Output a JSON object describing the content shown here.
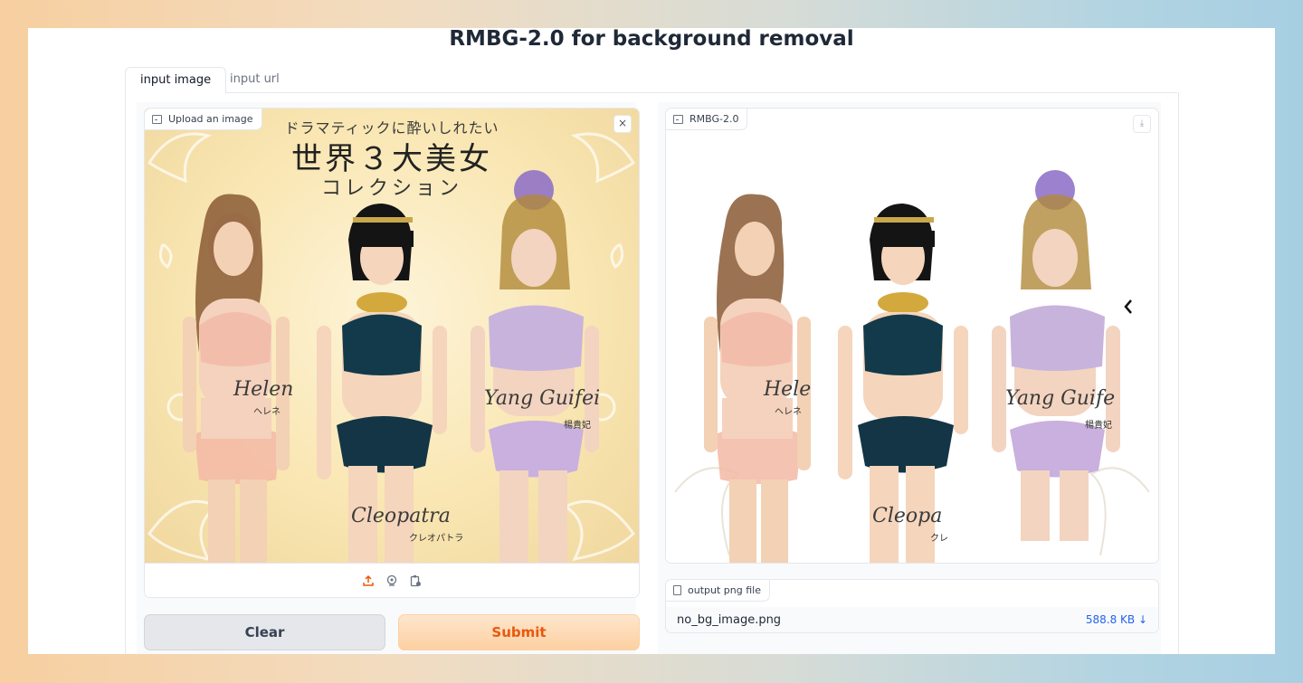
{
  "app": {
    "title": "RMBG-2.0 for background removal"
  },
  "tabs": [
    {
      "label": "input image",
      "active": true
    },
    {
      "label": "input url",
      "active": false
    }
  ],
  "input_panel": {
    "label": "Upload an image",
    "close_symbol": "×",
    "image_text": {
      "line1": "ドラマティックに酔いしれたい",
      "line2": "世界３大美女",
      "line3": "コレクション",
      "name_left": "Helen",
      "kana_left": "ヘレネ",
      "name_center": "Cleopatra",
      "kana_center": "クレオパトラ",
      "name_right": "Yang Guifei",
      "kana_right": "楊貴妃"
    },
    "source_icons": [
      "upload-icon",
      "webcam-icon",
      "clipboard-icon"
    ]
  },
  "output_panel": {
    "label": "RMBG-2.0",
    "image_text": {
      "name_left": "Hele",
      "kana_left": "ヘレネ",
      "name_center": "Cleopa",
      "kana_center": "クレ",
      "name_right": "Yang Guife",
      "kana_right": "楊貴妃"
    }
  },
  "file_output": {
    "label": "output png file",
    "file_name": "no_bg_image.png",
    "file_size": "588.8 KB ↓"
  },
  "buttons": {
    "clear": "Clear",
    "submit": "Submit"
  },
  "colors": {
    "accent": "#ea580c",
    "link": "#2563eb"
  }
}
